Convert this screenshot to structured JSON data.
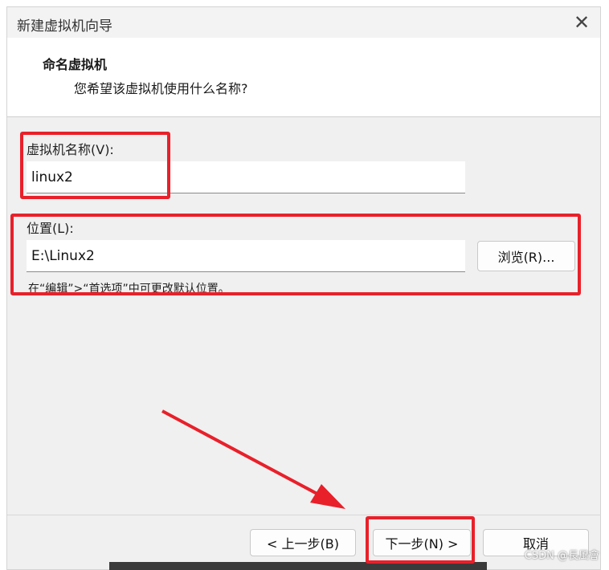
{
  "window": {
    "title": "新建虚拟机向导",
    "close_glyph": "✕"
  },
  "header": {
    "title": "命名虚拟机",
    "subtitle": "您希望该虚拟机使用什么名称?"
  },
  "form": {
    "name_label": "虚拟机名称(V):",
    "name_value": "linux2",
    "location_label": "位置(L):",
    "location_value": "E:\\Linux2",
    "browse_label": "浏览(R)...",
    "hint": "在“编辑”>“首选项”中可更改默认位置。"
  },
  "footer": {
    "back_label": "< 上一步(B)",
    "next_label": "下一步(N) >",
    "cancel_label": "取消"
  },
  "watermark": "CSDN @長風會",
  "annotation_color": "#e8202a"
}
